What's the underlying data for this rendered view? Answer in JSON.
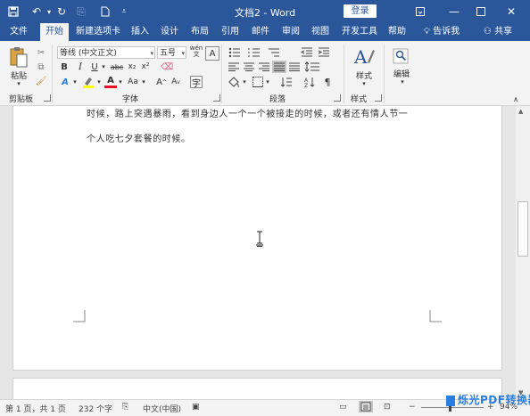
{
  "window": {
    "title": "文档2  -  Word",
    "login_label": "登录"
  },
  "tabs": [
    {
      "label": "文件"
    },
    {
      "label": "开始"
    },
    {
      "label": "新建选项卡"
    },
    {
      "label": "插入"
    },
    {
      "label": "设计"
    },
    {
      "label": "布局"
    },
    {
      "label": "引用"
    },
    {
      "label": "邮件"
    },
    {
      "label": "审阅"
    },
    {
      "label": "视图"
    },
    {
      "label": "开发工具"
    },
    {
      "label": "帮助"
    }
  ],
  "tell_me_label": "告诉我",
  "share_label": "共享",
  "ribbon": {
    "paste_label": "粘贴",
    "clipboard_group": "剪贴板",
    "font_name": "等线 (中文正文)",
    "font_size": "五号",
    "font_group": "字体",
    "paragraph_group": "段落",
    "styles_label": "样式",
    "styles_group": "样式",
    "edit_label": "编辑",
    "bold": "B",
    "italic": "I",
    "underline": "U",
    "strike": "abc",
    "subscript": "x₂",
    "superscript": "x²",
    "font_color": "A",
    "change_case": "Aa",
    "grow_font": "A",
    "shrink_font": "A",
    "wen": "wén"
  },
  "document": {
    "line1": "时候，路上突遇暴雨，看到身边人一个一个被接走的时候，或者还有情人节一",
    "line2": "个人吃七夕套餐的时候。"
  },
  "status": {
    "page": "第 1 页，共 1 页",
    "words": "232 个字",
    "language": "中文(中国)",
    "zoom": "94%"
  },
  "watermark": "烁光PDF转换器",
  "colors": {
    "brand": "#2b579a",
    "highlight": "#ffff00",
    "font_color": "#e81123"
  }
}
